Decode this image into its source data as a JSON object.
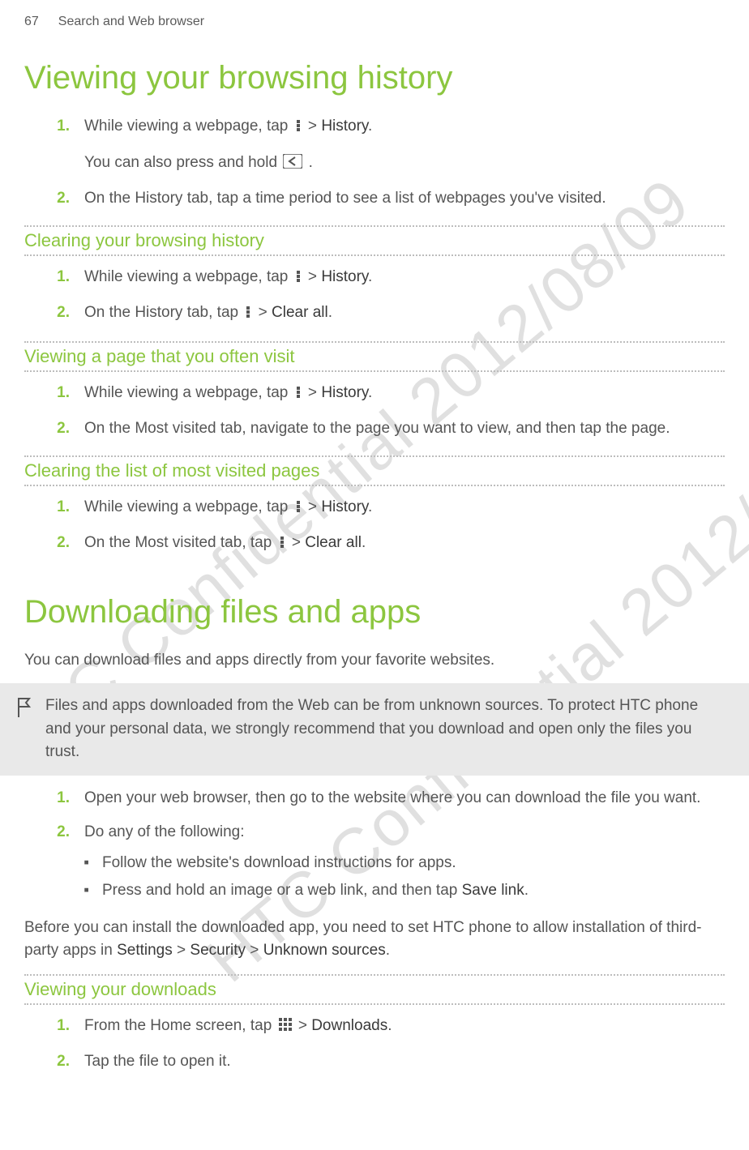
{
  "header": {
    "page_num": "67",
    "chapter": "Search and Web browser"
  },
  "watermark": "HTC Confidential  2012/08/09",
  "section1": {
    "title": "Viewing your browsing history",
    "steps": [
      {
        "num": "1.",
        "pre": "While viewing a webpage, tap ",
        "post": " > ",
        "action": "History",
        "tail": ".",
        "sub_pre": "You can also press and hold ",
        "sub_post": " ."
      },
      {
        "num": "2.",
        "text": "On the History tab, tap a time period to see a list of webpages you've visited."
      }
    ]
  },
  "section1a": {
    "title": "Clearing your browsing history",
    "steps": [
      {
        "num": "1.",
        "pre": "While viewing a webpage, tap ",
        "post": " > ",
        "action": "History",
        "tail": "."
      },
      {
        "num": "2.",
        "pre": "On the History tab, tap ",
        "post": " > ",
        "action": "Clear all",
        "tail": "."
      }
    ]
  },
  "section1b": {
    "title": "Viewing a page that you often visit",
    "steps": [
      {
        "num": "1.",
        "pre": "While viewing a webpage, tap ",
        "post": " > ",
        "action": "History",
        "tail": "."
      },
      {
        "num": "2.",
        "text": "On the Most visited tab, navigate to the page you want to view, and then tap the page."
      }
    ]
  },
  "section1c": {
    "title": "Clearing the list of most visited pages",
    "steps": [
      {
        "num": "1.",
        "pre": "While viewing a webpage, tap ",
        "post": " > ",
        "action": "History",
        "tail": "."
      },
      {
        "num": "2.",
        "pre": "On the Most visited tab, tap ",
        "post": " > ",
        "action": "Clear all",
        "tail": "."
      }
    ]
  },
  "section2": {
    "title": "Downloading files and apps",
    "intro": "You can download files and apps directly from your favorite websites.",
    "note": "Files and apps downloaded from the Web can be from unknown sources. To protect HTC phone and your personal data, we strongly recommend that you download and open only the files you trust.",
    "steps": [
      {
        "num": "1.",
        "text": "Open your web browser, then go to the website where you can download the file you want."
      },
      {
        "num": "2.",
        "text": "Do any of the following:",
        "bullets": [
          {
            "text": "Follow the website's download instructions for apps."
          },
          {
            "pre": "Press and hold an image or a web link, and then tap ",
            "action": "Save link",
            "tail": "."
          }
        ]
      }
    ],
    "closing_pre": "Before you can install the downloaded app, you need to set HTC phone to allow installation of third-party apps in ",
    "settings": "Settings",
    "sep1": " > ",
    "security": "Security",
    "sep2": " > ",
    "unknown": "Unknown sources",
    "closing_tail": "."
  },
  "section2a": {
    "title": "Viewing your downloads",
    "steps": [
      {
        "num": "1.",
        "pre": "From the Home screen, tap ",
        "post": " > ",
        "action": "Downloads",
        "tail": "."
      },
      {
        "num": "2.",
        "text": "Tap the file to open it."
      }
    ]
  }
}
